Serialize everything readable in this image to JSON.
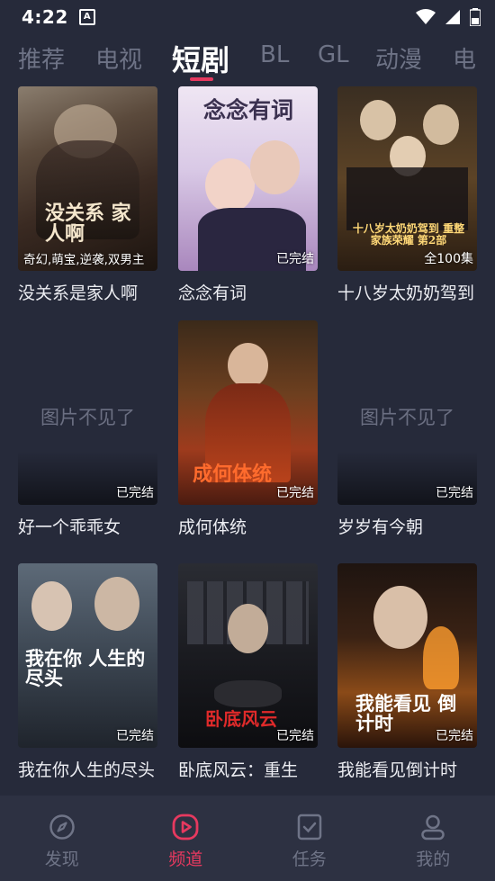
{
  "status": {
    "time": "4:22"
  },
  "tabs": [
    "推荐",
    "电视",
    "短剧",
    "BL",
    "GL",
    "动漫",
    "电"
  ],
  "cards": [
    {
      "title": "没关系是家人啊",
      "tag": "奇幻,萌宝,逆袭,双男主",
      "art": "没关系 家人啊",
      "missing": false
    },
    {
      "title": "念念有词",
      "tag": "已完结",
      "art": "念念有词",
      "missing": false
    },
    {
      "title": "十八岁太奶奶驾到",
      "tag": "全100集",
      "art": "十八岁太奶奶驾到 重整家族荣耀 第2部",
      "missing": false
    },
    {
      "title": "好一个乖乖女",
      "tag": "已完结",
      "missing": true
    },
    {
      "title": "成何体统",
      "tag": "已完结",
      "art": "成何体统",
      "missing": false
    },
    {
      "title": "岁岁有今朝",
      "tag": "已完结",
      "missing": true
    },
    {
      "title": "我在你人生的尽头",
      "tag": "已完结",
      "art": "我在你 人生的尽头",
      "missing": false
    },
    {
      "title": "卧底风云：重生",
      "tag": "已完结",
      "art": "卧底风云",
      "missing": false
    },
    {
      "title": "我能看见倒计时",
      "tag": "已完结",
      "art": "我能看见 倒计时",
      "missing": false
    }
  ],
  "missing_text": "图片不见了",
  "nav": [
    {
      "label": "发现",
      "icon": "compass-icon"
    },
    {
      "label": "频道",
      "icon": "play-icon"
    },
    {
      "label": "任务",
      "icon": "task-check-icon"
    },
    {
      "label": "我的",
      "icon": "user-icon"
    }
  ],
  "colors": {
    "accent": "#e6395f",
    "background": "#262a3a",
    "nav_bg": "#2d3142"
  }
}
